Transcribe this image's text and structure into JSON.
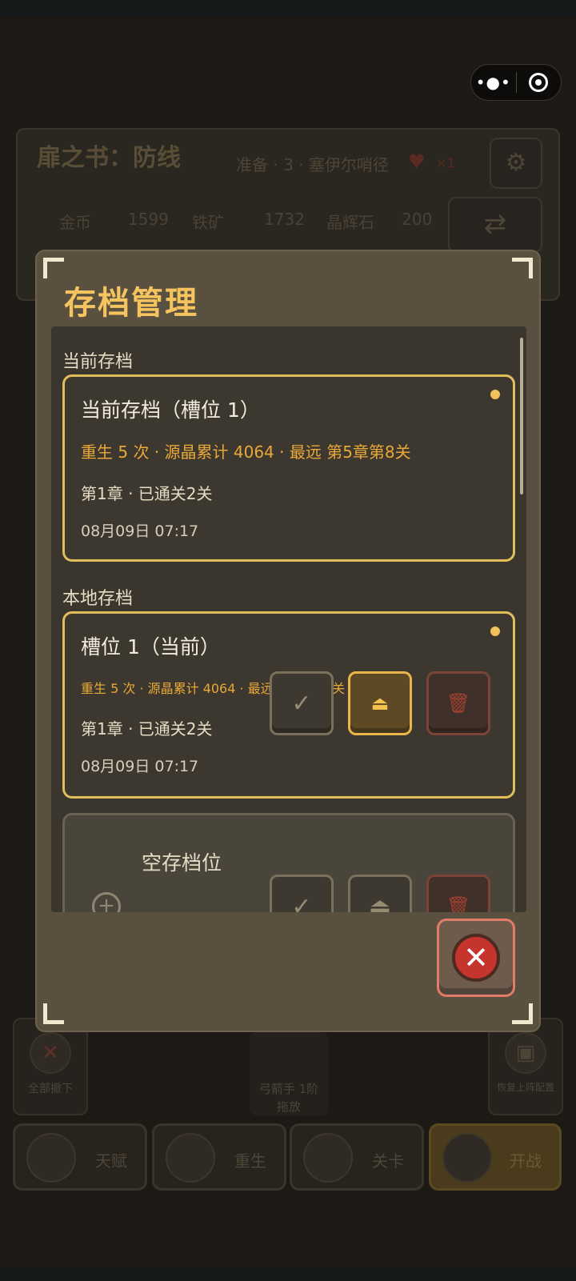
{
  "capsule": {
    "more": "•●•",
    "close": ""
  },
  "background": {
    "title": "扉之书：防线",
    "stage": "准备 · 3 · 塞伊尔哨径",
    "lives_prefix": "×",
    "lives": "1",
    "resources": [
      {
        "name": "金币",
        "value": "1599"
      },
      {
        "name": "铁矿",
        "value": "1732"
      },
      {
        "name": "晶辉石",
        "value": "200"
      }
    ],
    "bottom": {
      "clear_all": "全部撤下",
      "unit_name": "弓箭手 1阶",
      "unit_hint": "拖放",
      "restore": "恢复上阵配置"
    },
    "nav": [
      {
        "label": "天赋",
        "icon": "tree-icon"
      },
      {
        "label": "重生",
        "icon": "feather-icon"
      },
      {
        "label": "关卡",
        "icon": "sword-icon"
      },
      {
        "label": "开战",
        "icon": "skull-icon"
      }
    ]
  },
  "modal": {
    "title": "存档管理",
    "current_section": "当前存档",
    "current": {
      "title": "当前存档（槽位 1）",
      "summary": "重生 5 次 · 源晶累计 4064 · 最远 第5章第8关",
      "progress": "第1章 · 已通关2关",
      "date": "08月09日 07:17"
    },
    "local_section": "本地存档",
    "slots": [
      {
        "title": "槽位 1（当前）",
        "summary": "重生 5 次 · 源晶累计 4064 · 最远 第5章第8关",
        "progress": "第1章 · 已通关2关",
        "date": "08月09日 07:17"
      },
      {
        "title": "空存档位"
      }
    ],
    "actions": {
      "save": "✓",
      "load": "⏏",
      "delete": "🗑"
    },
    "close": "✕"
  },
  "colors": {
    "accent": "#f5c45e",
    "card_border": "#e2bd5c",
    "danger": "#c5352d",
    "modal_bg": "#5a5040"
  }
}
